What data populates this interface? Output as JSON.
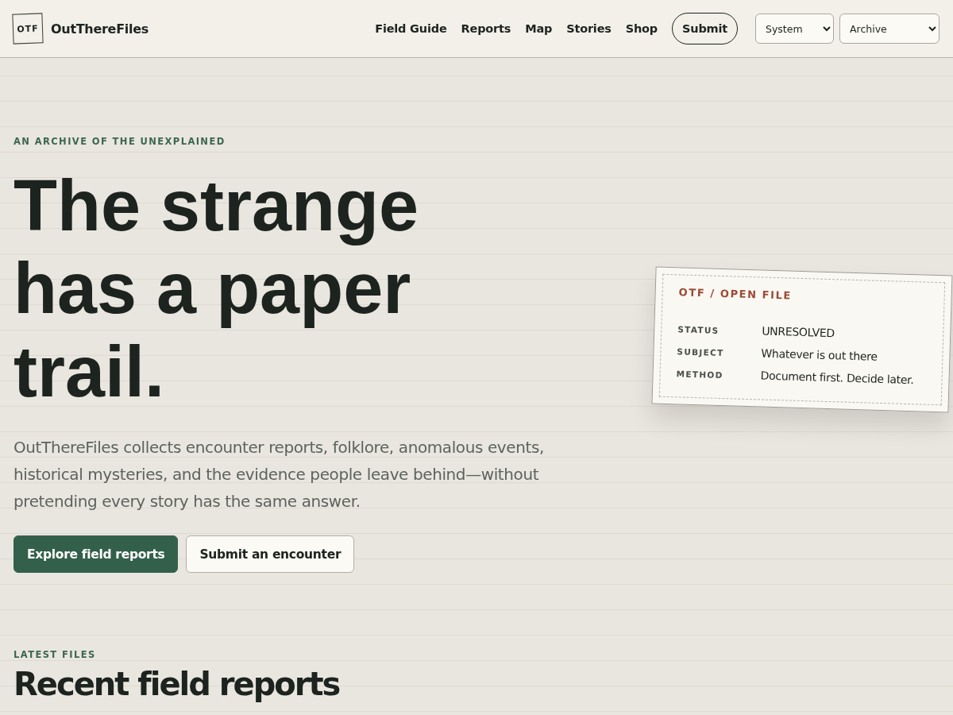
{
  "brand": {
    "mark": "OTF",
    "name": "OutThereFiles"
  },
  "nav": [
    {
      "label": "Field Guide",
      "kind": "link"
    },
    {
      "label": "Reports",
      "kind": "link"
    },
    {
      "label": "Map",
      "kind": "link"
    },
    {
      "label": "Stories",
      "kind": "link"
    },
    {
      "label": "Shop",
      "kind": "link"
    },
    {
      "label": "Submit",
      "kind": "pill"
    }
  ],
  "selects": [
    {
      "value": "System"
    },
    {
      "value": "Archive"
    }
  ],
  "hero": {
    "eyebrow": "AN ARCHIVE OF THE UNEXPLAINED",
    "title_lines": [
      "The strange",
      "has a paper",
      "trail."
    ],
    "lead": "OutThereFiles collects encounter reports, folklore, anomalous events, historical mysteries, and the evidence people leave behind—without pretending every story has the same answer.",
    "buttons": [
      {
        "label": "Explore field reports",
        "kind": "primary"
      },
      {
        "label": "Submit an encounter",
        "kind": "secondary"
      }
    ]
  },
  "file_card": {
    "title": "OTF / OPEN FILE",
    "rows": [
      {
        "label": "STATUS",
        "value": "UNRESOLVED"
      },
      {
        "label": "SUBJECT",
        "value": "Whatever is out there"
      },
      {
        "label": "METHOD",
        "value": "Document first. Decide later."
      }
    ]
  },
  "latest": {
    "eyebrow": "LATEST FILES",
    "title": "Recent field reports"
  }
}
